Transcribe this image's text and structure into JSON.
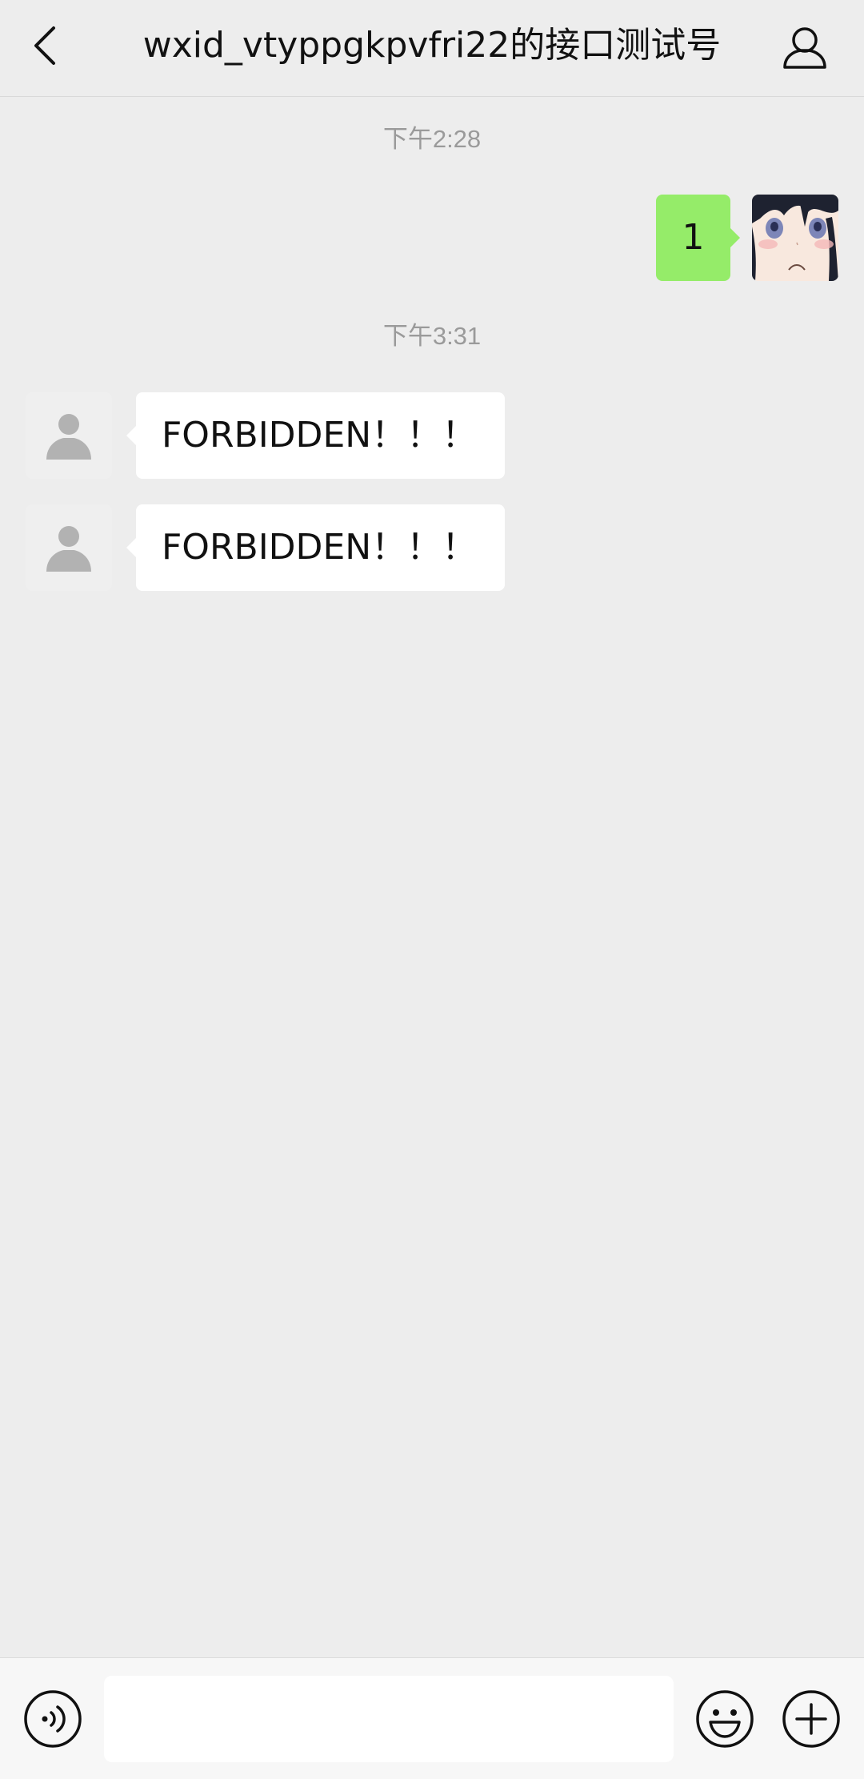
{
  "header": {
    "title": "wxid_vtyppgkpvfri22的接口测试号",
    "back_icon": "chevron-left-icon",
    "profile_icon": "person-outline-icon"
  },
  "messages": [
    {
      "type": "time",
      "text": "下午2:28"
    },
    {
      "type": "sent",
      "text": "1",
      "avatar": "anime-character-avatar"
    },
    {
      "type": "time",
      "text": "下午3:31"
    },
    {
      "type": "received",
      "text": "FORBIDDEN！！！",
      "avatar": "default-user-icon"
    },
    {
      "type": "received",
      "text": "FORBIDDEN！！！",
      "avatar": "default-user-icon"
    }
  ],
  "input_bar": {
    "message_value": "",
    "voice_icon": "voice-input-icon",
    "emoji_icon": "emoji-icon",
    "more_icon": "plus-circle-icon"
  },
  "colors": {
    "background": "#EDEDED",
    "sent_bubble": "#95EC69",
    "received_bubble": "#FFFFFF",
    "timestamp_text": "#9A9A9A"
  }
}
